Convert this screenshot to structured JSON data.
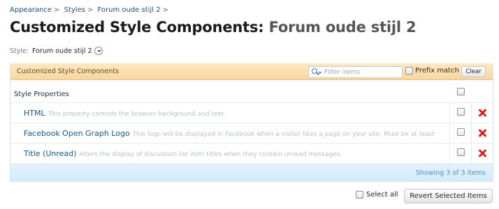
{
  "breadcrumb": [
    "Appearance",
    "Styles",
    "Forum oude stijl 2"
  ],
  "breadcrumb_sep": ">",
  "page_title": {
    "main": "Customized Style Components:",
    "sub": "Forum oude stijl 2"
  },
  "style_selector": {
    "label": "Style:",
    "value": "Forum oude stijl 2"
  },
  "panel": {
    "title": "Customized Style Components",
    "filter_placeholder": "Filter items",
    "prefix_label": "Prefix match",
    "clear_label": "Clear"
  },
  "section": {
    "title": "Style Properties"
  },
  "items": [
    {
      "name": "HTML",
      "description": "This property controls the browser background and text."
    },
    {
      "name": "Facebook Open Graph Logo",
      "description": "This logo will be displayed in Facebook when a visitor likes a page on your site. Must be at least"
    },
    {
      "name": "Title (Unread)",
      "description": "Alters the display of discussion list item titles when they contain unread messages."
    }
  ],
  "footer": {
    "count_text": "Showing 3 of 3 items"
  },
  "actions": {
    "select_all_label": "Select all",
    "revert_label": "Revert Selected Items"
  },
  "colors": {
    "panel_header_bg": "#fadeb0",
    "footer_bg": "#dcefff",
    "link": "#17548a",
    "delete": "#d8221a"
  },
  "icons": [
    "search-icon",
    "chevron-down-icon",
    "delete-icon"
  ]
}
